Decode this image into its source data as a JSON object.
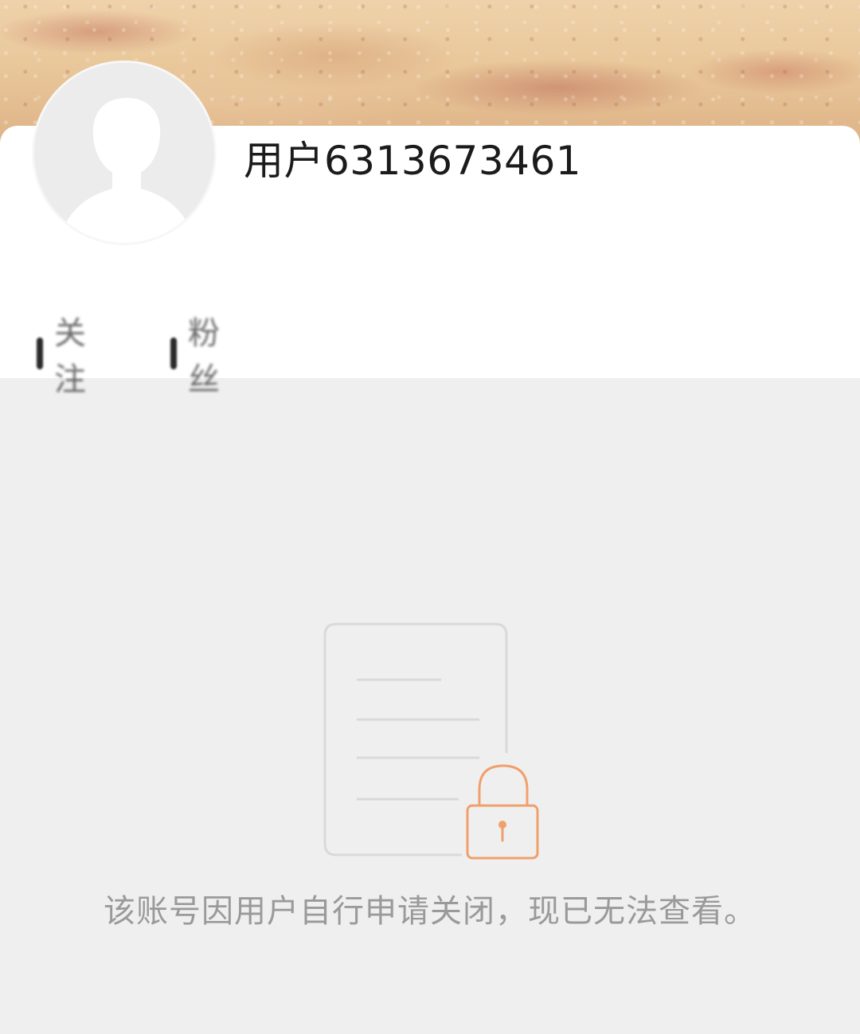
{
  "profile": {
    "username": "用户6313673461",
    "stats": [
      {
        "count": "",
        "label": "关注"
      },
      {
        "count": "",
        "label": "粉丝"
      }
    ]
  },
  "status": {
    "message": "该账号因用户自行申请关闭，现已无法查看。"
  },
  "icons": {
    "avatar": "default-avatar-icon",
    "locked_document": "locked-document-icon"
  },
  "colors": {
    "lock_accent": "#f0a06c",
    "page_background": "#efefef",
    "card_background": "#ffffff"
  }
}
